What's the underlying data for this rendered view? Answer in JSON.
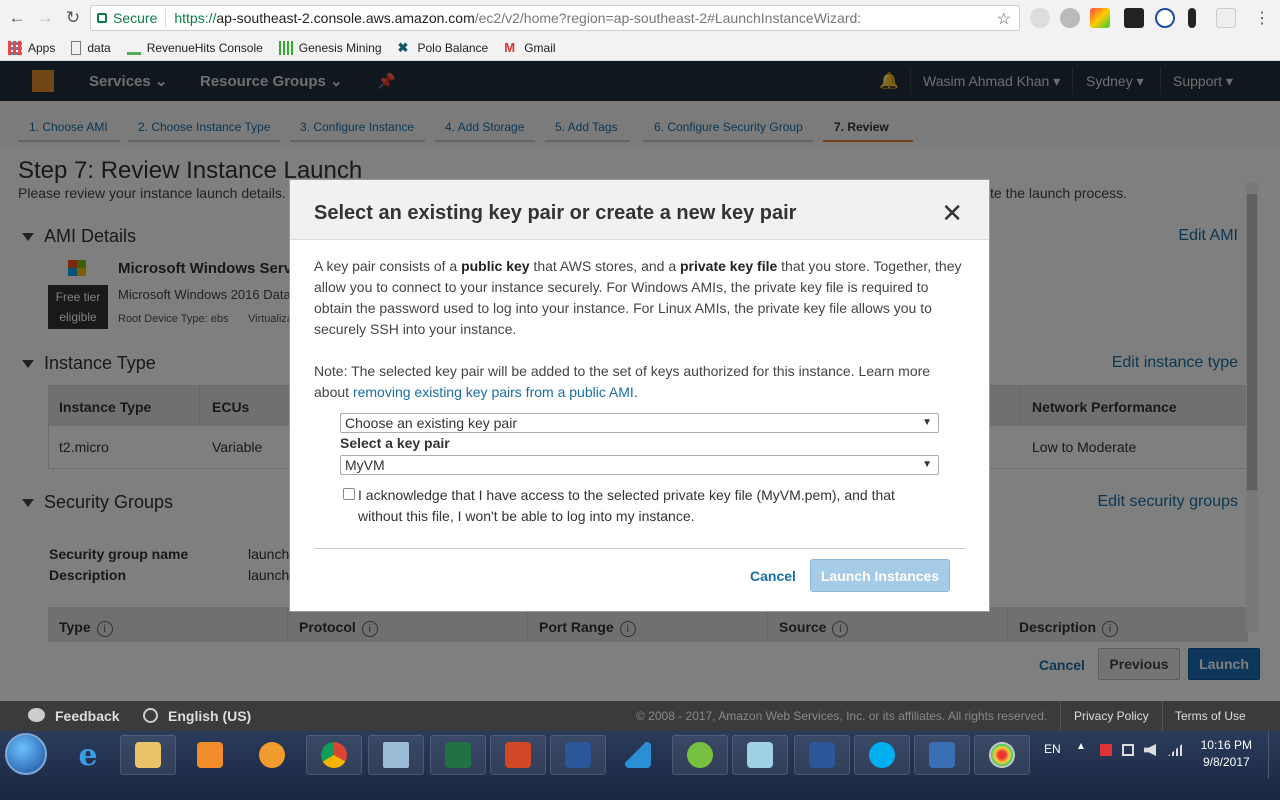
{
  "browser": {
    "secure_label": "Secure",
    "url_proto": "https://",
    "url_host": "ap-southeast-2.console.aws.amazon.com",
    "url_rest": "/ec2/v2/home?region=ap-southeast-2#LaunchInstanceWizard:",
    "bookmarks": [
      "Apps",
      "data",
      "RevenueHits Console",
      "Genesis Mining",
      "Polo Balance",
      "Gmail"
    ]
  },
  "awsnav": {
    "services": "Services",
    "resource_groups": "Resource Groups",
    "user": "Wasim Ahmad Khan",
    "region": "Sydney",
    "support": "Support"
  },
  "wizard": {
    "tabs": [
      "1. Choose AMI",
      "2. Choose Instance Type",
      "3. Configure Instance",
      "4. Add Storage",
      "5. Add Tags",
      "6. Configure Security Group",
      "7. Review"
    ]
  },
  "page": {
    "title": "Step 7: Review Instance Launch",
    "subtitle_left": "Please review your instance launch details.",
    "subtitle_right": "te the launch process.",
    "ami_section": "AMI Details",
    "edit_ami": "Edit AMI",
    "ami_name": "Microsoft Windows Serv",
    "ami_desc": "Microsoft Windows 2016 Data",
    "ami_meta": "Root Device Type: ebs",
    "ami_meta2": "Virtualiza",
    "free_tier_1": "Free tier",
    "free_tier_2": "eligible",
    "instance_section": "Instance Type",
    "edit_instance": "Edit instance type",
    "it_headers": [
      "Instance Type",
      "ECUs",
      "Network Performance"
    ],
    "it_row": [
      "t2.micro",
      "Variable",
      "Low to Moderate"
    ],
    "sg_section": "Security Groups",
    "edit_sg": "Edit security groups",
    "sg_name_label": "Security group name",
    "sg_desc_label": "Description",
    "sg_name_val": "launch",
    "sg_desc_val": "launch",
    "rule_headers": [
      "Type",
      "Protocol",
      "Port Range",
      "Source",
      "Description"
    ],
    "info_glyph": "i",
    "cancel": "Cancel",
    "previous": "Previous",
    "launch": "Launch"
  },
  "modal": {
    "title": "Select an existing key pair or create a new key pair",
    "close": "✕",
    "p1_a": "A key pair consists of a ",
    "p1_b": "public key",
    "p1_c": " that AWS stores, and a ",
    "p1_d": "private key file",
    "p1_e": " that you store. Together, they allow you to connect to your instance securely. For Windows AMIs, the private key file is required to obtain the password used to log into your instance. For Linux AMIs, the private key file allows you to securely SSH into your instance.",
    "p2_a": "Note: The selected key pair will be added to the set of keys authorized for this instance. Learn more about ",
    "p2_link": "removing existing key pairs from a public AMI",
    "p2_b": ".",
    "select1": "Choose an existing key pair",
    "select_label": "Select a key pair",
    "select2": "MyVM",
    "ack": "I acknowledge that I have access to the selected private key file (MyVM.pem), and that without this file, I won't be able to log into my instance.",
    "cancel": "Cancel",
    "launch": "Launch Instances"
  },
  "footer": {
    "feedback": "Feedback",
    "language": "English (US)",
    "copyright": "© 2008 - 2017, Amazon Web Services, Inc. or its affiliates. All rights reserved.",
    "privacy": "Privacy Policy",
    "terms": "Terms of Use"
  },
  "taskbar": {
    "lang": "EN",
    "time": "10:16 PM",
    "date": "9/8/2017"
  }
}
